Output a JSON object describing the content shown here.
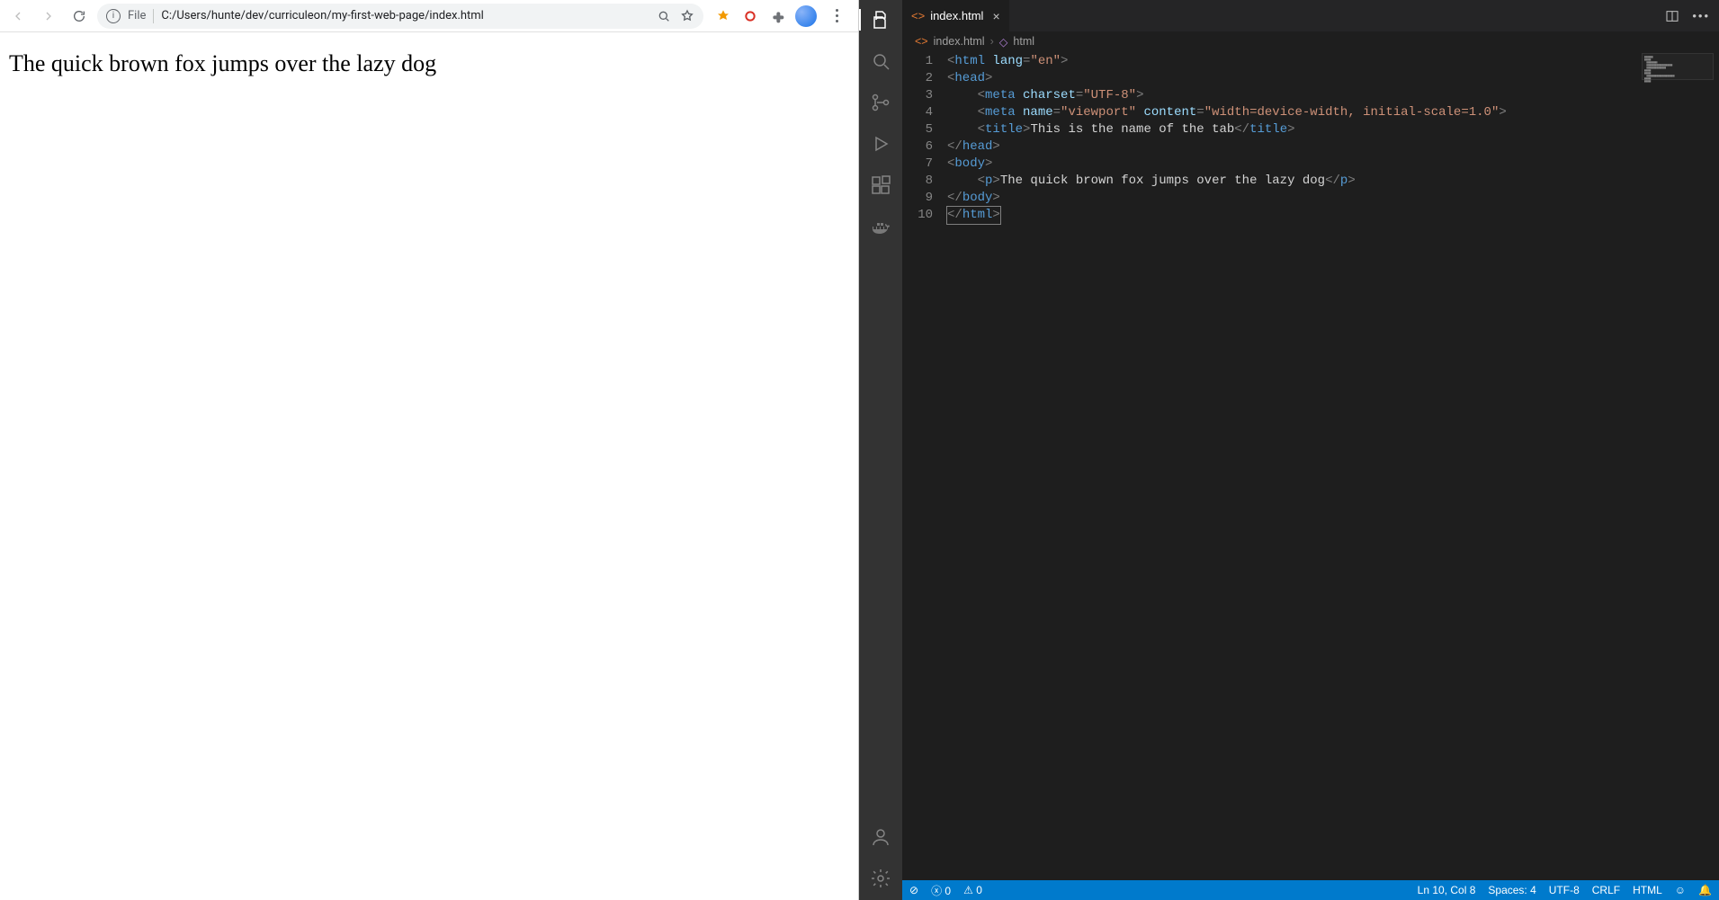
{
  "browser": {
    "address": {
      "scheme_label": "File",
      "path": "C:/Users/hunte/dev/curriculeon/my-first-web-page/index.html"
    },
    "page_text": "The quick brown fox jumps over the lazy dog"
  },
  "vscode": {
    "tab": {
      "filename": "index.html"
    },
    "breadcrumbs": {
      "file": "index.html",
      "symbol": "html"
    },
    "code": {
      "lines": [
        {
          "n": 1,
          "tokens": [
            [
              "punc",
              "<"
            ],
            [
              "tag",
              "html "
            ],
            [
              "attr",
              "lang"
            ],
            [
              "punc",
              "="
            ],
            [
              "str",
              "\"en\""
            ],
            [
              "punc",
              ">"
            ]
          ],
          "indent": 0
        },
        {
          "n": 2,
          "tokens": [
            [
              "punc",
              "<"
            ],
            [
              "tag",
              "head"
            ],
            [
              "punc",
              ">"
            ]
          ],
          "indent": 0
        },
        {
          "n": 3,
          "tokens": [
            [
              "punc",
              "<"
            ],
            [
              "tag",
              "meta "
            ],
            [
              "attr",
              "charset"
            ],
            [
              "punc",
              "="
            ],
            [
              "str",
              "\"UTF-8\""
            ],
            [
              "punc",
              ">"
            ]
          ],
          "indent": 1
        },
        {
          "n": 4,
          "tokens": [
            [
              "punc",
              "<"
            ],
            [
              "tag",
              "meta "
            ],
            [
              "attr",
              "name"
            ],
            [
              "punc",
              "="
            ],
            [
              "str",
              "\"viewport\" "
            ],
            [
              "attr",
              "content"
            ],
            [
              "punc",
              "="
            ],
            [
              "str",
              "\"width=device-width, initial-scale=1.0\""
            ],
            [
              "punc",
              ">"
            ]
          ],
          "indent": 1
        },
        {
          "n": 5,
          "tokens": [
            [
              "punc",
              "<"
            ],
            [
              "tag",
              "title"
            ],
            [
              "punc",
              ">"
            ],
            [
              "text",
              "This is the name of the tab"
            ],
            [
              "punc",
              "</"
            ],
            [
              "tag",
              "title"
            ],
            [
              "punc",
              ">"
            ]
          ],
          "indent": 1
        },
        {
          "n": 6,
          "tokens": [
            [
              "punc",
              "</"
            ],
            [
              "tag",
              "head"
            ],
            [
              "punc",
              ">"
            ]
          ],
          "indent": 0
        },
        {
          "n": 7,
          "tokens": [
            [
              "punc",
              "<"
            ],
            [
              "tag",
              "body"
            ],
            [
              "punc",
              ">"
            ]
          ],
          "indent": 0
        },
        {
          "n": 8,
          "tokens": [
            [
              "punc",
              "<"
            ],
            [
              "tag",
              "p"
            ],
            [
              "punc",
              ">"
            ],
            [
              "text",
              "The quick brown fox jumps over the lazy dog"
            ],
            [
              "punc",
              "</"
            ],
            [
              "tag",
              "p"
            ],
            [
              "punc",
              ">"
            ]
          ],
          "indent": 1
        },
        {
          "n": 9,
          "tokens": [
            [
              "punc",
              "</"
            ],
            [
              "tag",
              "body"
            ],
            [
              "punc",
              ">"
            ]
          ],
          "indent": 0
        },
        {
          "n": 10,
          "tokens": [
            [
              "punc",
              "</"
            ],
            [
              "tag",
              "html"
            ],
            [
              "punc",
              ">"
            ]
          ],
          "indent": 0,
          "cursor": true
        }
      ]
    },
    "statusbar": {
      "errors": "0",
      "warnings": "0",
      "ln_col": "Ln 10, Col 8",
      "spaces": "Spaces: 4",
      "encoding": "UTF-8",
      "eol": "CRLF",
      "lang": "HTML"
    }
  }
}
